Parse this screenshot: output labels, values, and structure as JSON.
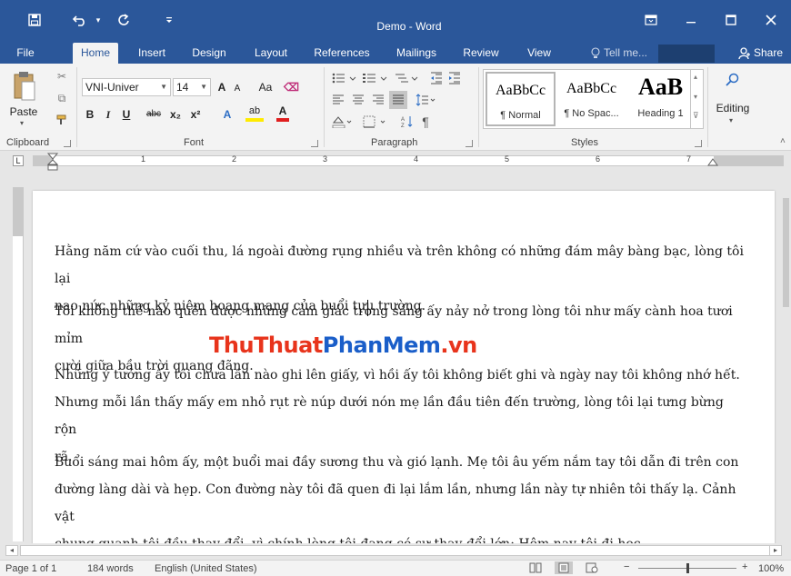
{
  "window": {
    "title": "Demo - Word",
    "colors": {
      "accent": "#2b579a",
      "ribbon_bg": "#f3f3f3",
      "doc_bg": "#e6e6e6",
      "watermark_red": "#e8341c",
      "watermark_blue": "#1a5ec9"
    }
  },
  "qat": {
    "save_icon": "save-icon",
    "undo_icon": "undo-icon",
    "redo_icon": "redo-icon",
    "customize_icon": "customize-qat-icon"
  },
  "tabs": [
    {
      "label": "File"
    },
    {
      "label": "Home"
    },
    {
      "label": "Insert"
    },
    {
      "label": "Design"
    },
    {
      "label": "Layout"
    },
    {
      "label": "References"
    },
    {
      "label": "Mailings"
    },
    {
      "label": "Review"
    },
    {
      "label": "View"
    }
  ],
  "tell_me": "Tell me...",
  "share": "Share",
  "ribbon": {
    "clipboard": {
      "label": "Clipboard",
      "paste": "Paste"
    },
    "font": {
      "label": "Font",
      "font_name": "VNI-Univer",
      "font_size": "14",
      "grow": "A",
      "shrink": "A",
      "change_case": "Aa",
      "bold": "B",
      "italic": "I",
      "underline": "U",
      "strikethrough": "abc",
      "subscript": "x₂",
      "superscript": "x²",
      "effects": "A",
      "highlight": "ab",
      "font_color": "A"
    },
    "paragraph": {
      "label": "Paragraph",
      "pilcrow": "¶"
    },
    "styles": {
      "label": "Styles",
      "items": [
        {
          "preview": "AaBbCc",
          "name": "¶ Normal"
        },
        {
          "preview": "AaBbCc",
          "name": "¶ No Spac..."
        },
        {
          "preview": "AaB",
          "name": "Heading 1"
        }
      ]
    },
    "editing": {
      "label": "Editing"
    }
  },
  "ruler": {
    "numbers": [
      "1",
      "2",
      "3",
      "4",
      "5",
      "6",
      "7"
    ]
  },
  "document": {
    "paragraphs": [
      {
        "lines": [
          "Hằng năm cứ vào cuối thu, lá ngoài đường rụng nhiều và trên không có những đám mây bàng bạc, lòng tôi lại",
          "nao nức những kỷ niệm hoang mang của buổi tựu trường."
        ]
      },
      {
        "lines": [
          "Tôi không thể nào quên được những cảm giác trong sáng ấy nảy nở trong lòng tôi như mấy cành hoa tươi mỉm",
          "cười giữa bầu trời quang đãng."
        ]
      },
      {
        "lines": [
          "Những ý tưởng ấy tôi chưa lần nào ghi lên giấy, vì hồi ấy tôi không biết ghi và ngày nay tôi không nhớ hết.",
          "Nhưng mỗi lần thấy mấy em nhỏ rụt rè núp dưới nón mẹ lần đầu tiên đến trường, lòng tôi lại tưng bừng rộn",
          "rã."
        ]
      },
      {
        "lines": [
          "Buổi sáng mai hôm ấy, một buổi mai đầy sương thu và gió lạnh. Mẹ tôi âu yếm nắm tay tôi dẫn đi trên con",
          "đường làng dài và hẹp. Con đường này tôi đã quen đi lại lắm lần, nhưng lần này tự nhiên tôi thấy lạ. Cảnh vật",
          "chung quanh tôi đều thay đổi, vì chính lòng tôi đang có sự thay đổi lớn: Hôm nay tôi đi học."
        ]
      }
    ]
  },
  "watermark": {
    "part1": "ThuThuat",
    "part2": "PhanMem",
    "part3": ".vn"
  },
  "status": {
    "page": "Page 1 of 1",
    "words": "184 words",
    "language": "English (United States)",
    "zoom": "100%",
    "zoom_level": 1.0
  }
}
